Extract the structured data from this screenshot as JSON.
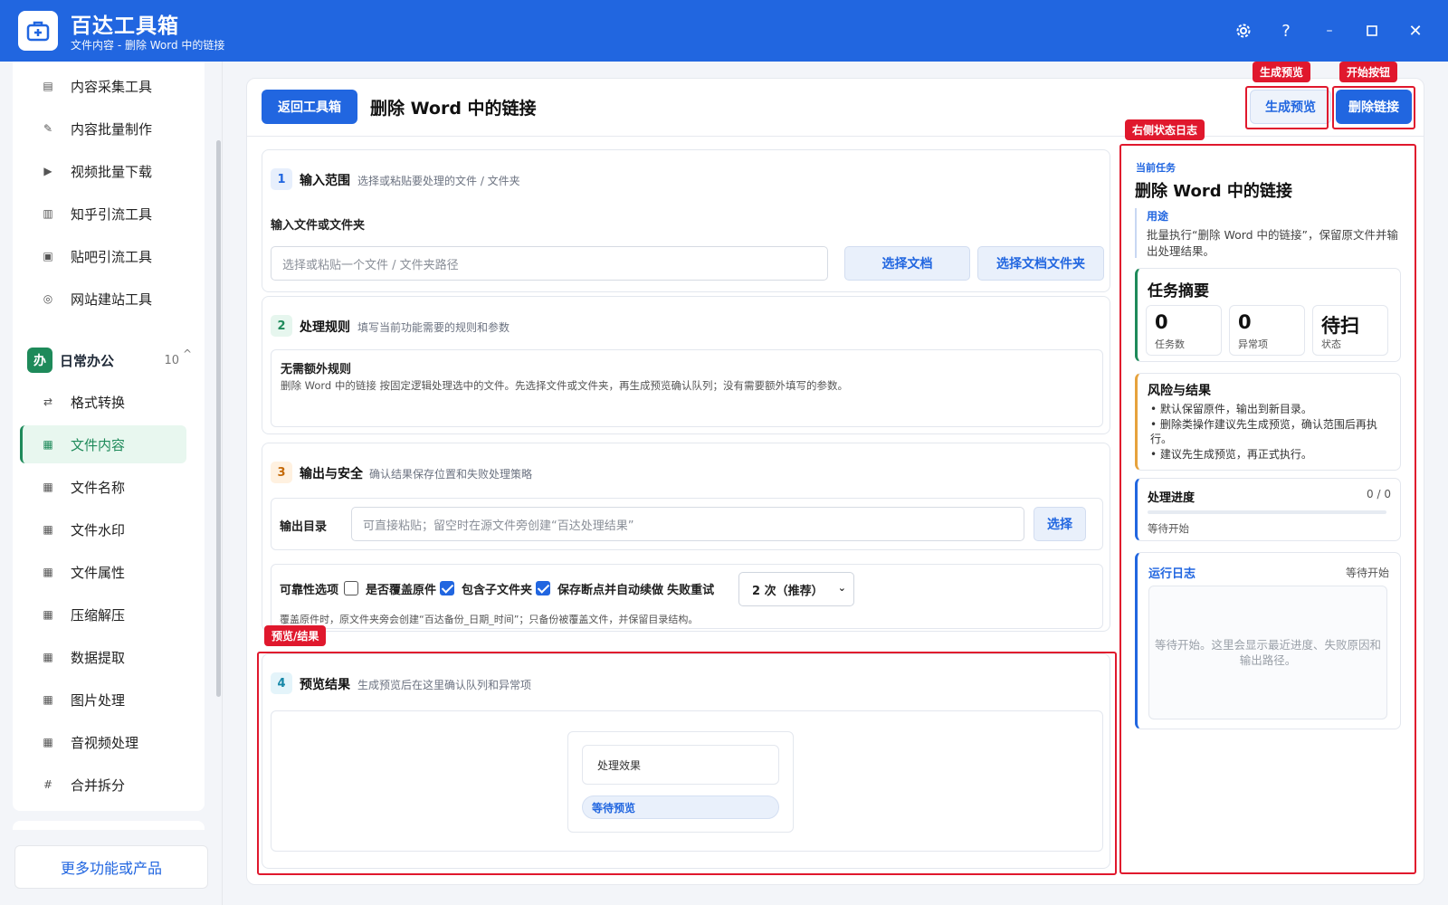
{
  "app": {
    "title": "百达工具箱",
    "subtitle": "文件内容 - 删除 Word 中的链接",
    "window_controls": [
      "settings",
      "help",
      "minimize",
      "maximize",
      "close"
    ]
  },
  "sidebar": {
    "top_items": [
      {
        "label": "内容采集工具",
        "icon": "doc-collect-icon"
      },
      {
        "label": "内容批量制作",
        "icon": "pen-icon"
      },
      {
        "label": "视频批量下载",
        "icon": "video-icon"
      },
      {
        "label": "知乎引流工具",
        "icon": "zhihu-icon"
      },
      {
        "label": "贴吧引流工具",
        "icon": "tieba-icon"
      },
      {
        "label": "网站建站工具",
        "icon": "web-icon"
      }
    ],
    "group": {
      "badge": "办",
      "title": "日常办公",
      "count": "10",
      "caret": "^"
    },
    "group_items": [
      {
        "label": "格式转换",
        "icon": "swap-icon"
      },
      {
        "label": "文件内容",
        "icon": "grid-icon"
      },
      {
        "label": "文件名称",
        "icon": "grid-icon"
      },
      {
        "label": "文件水印",
        "icon": "grid-icon"
      },
      {
        "label": "文件属性",
        "icon": "grid-icon"
      },
      {
        "label": "压缩解压",
        "icon": "grid-icon"
      },
      {
        "label": "数据提取",
        "icon": "grid-icon"
      },
      {
        "label": "图片处理",
        "icon": "grid-icon"
      },
      {
        "label": "音视频处理",
        "icon": "grid-icon"
      },
      {
        "label": "合并拆分",
        "icon": "hash-icon"
      }
    ],
    "more_button": "更多功能或产品"
  },
  "toolbar": {
    "back_label": "返回工具箱",
    "page_title": "删除 Word 中的链接",
    "preview_label": "生成预览",
    "start_label": "删除链接"
  },
  "annotations": {
    "preview": "生成预览",
    "start": "开始按钮",
    "right_log": "右侧状态日志",
    "preview_result": "预览/结果"
  },
  "section1": {
    "num": "1",
    "title": "输入范围",
    "desc": "选择或粘贴要处理的文件 / 文件夹",
    "field_label": "输入文件或文件夹",
    "placeholder": "选择或粘贴一个文件 / 文件夹路径",
    "btn_doc": "选择文档",
    "btn_folder": "选择文档文件夹"
  },
  "section2": {
    "num": "2",
    "title": "处理规则",
    "desc": "填写当前功能需要的规则和参数",
    "rule_title": "无需额外规则",
    "rule_desc": "删除 Word 中的链接 按固定逻辑处理选中的文件。先选择文件或文件夹，再生成预览确认队列；没有需要额外填写的参数。"
  },
  "section3": {
    "num": "3",
    "title": "输出与安全",
    "desc": "确认结果保存位置和失败处理策略",
    "output_label": "输出目录",
    "output_placeholder": "可直接粘贴；留空时在源文件旁创建“百达处理结果”",
    "output_btn": "选择",
    "reliability_label": "可靠性选项",
    "opt_overwrite": "是否覆盖原件",
    "opt_overwrite_checked": false,
    "opt_subfolders": "包含子文件夹",
    "opt_subfolders_checked": true,
    "opt_resume": "保存断点并自动续做",
    "opt_resume_checked": true,
    "retry_label": "失败重试",
    "retry_value": "2 次（推荐）",
    "note": "覆盖原件时，原文件夹旁会创建“百达备份_日期_时间”；只备份被覆盖文件，并保留目录结构。"
  },
  "section4": {
    "num": "4",
    "title": "预览结果",
    "desc": "生成预览后在这里确认队列和异常项",
    "effect_label": "处理效果",
    "status_pill": "等待预览"
  },
  "right_panel": {
    "current_task_label": "当前任务",
    "current_task_title": "删除 Word 中的链接",
    "purpose_label": "用途",
    "purpose_text": "批量执行“删除 Word 中的链接”，保留原文件并输出处理结果。",
    "summary": {
      "title": "任务摘要",
      "stats": [
        {
          "value": "0",
          "label": "任务数"
        },
        {
          "value": "0",
          "label": "异常项"
        },
        {
          "value": "待扫",
          "label": "状态"
        }
      ]
    },
    "risk": {
      "title": "风险与结果",
      "bullets": [
        "默认保留原件，输出到新目录。",
        "删除类操作建议先生成预览，确认范围后再执行。",
        "建议先生成预览，再正式执行。"
      ]
    },
    "progress": {
      "title": "处理进度",
      "count": "0 / 0",
      "fraction": 0,
      "status": "等待开始"
    },
    "log": {
      "title": "运行日志",
      "status": "等待开始",
      "placeholder": "等待开始。这里会显示最近进度、失败原因和输出路径。"
    }
  },
  "colors": {
    "titlebar": "#2166e0",
    "accent_green": "#1e8a5a",
    "annotation_red": "#e0182d"
  }
}
